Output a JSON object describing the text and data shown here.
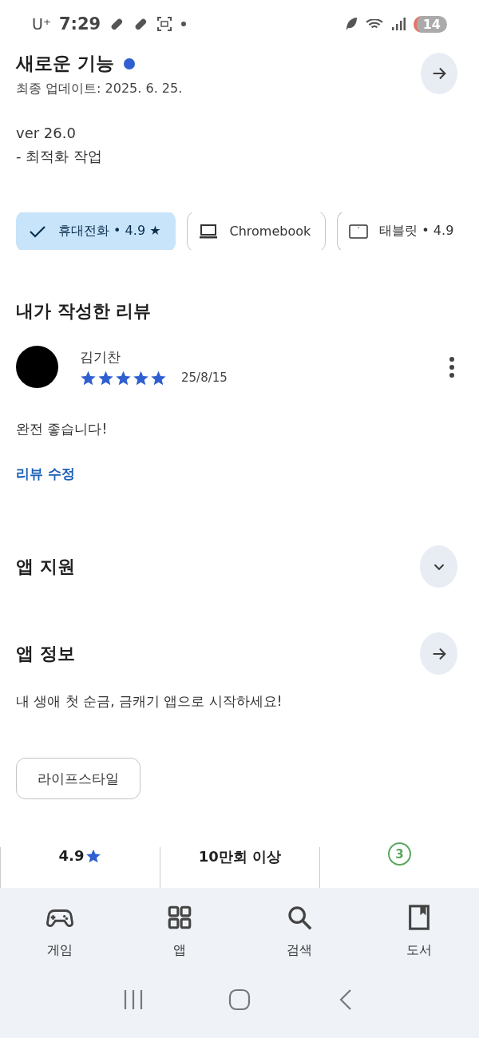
{
  "status_bar": {
    "carrier": "U⁺",
    "time": "7:29",
    "battery": "14"
  },
  "whats_new": {
    "title": "새로운 기능",
    "new_badge": true,
    "updated": "최종 업데이트: 2025. 6. 25.",
    "notes": [
      "ver 26.0",
      "- 최적화 작업"
    ]
  },
  "device_chips": [
    {
      "kind": "check",
      "label": "휴대전화 • 4.9 ★",
      "selected": true
    },
    {
      "kind": "laptop",
      "label": "Chromebook",
      "selected": false
    },
    {
      "kind": "tablet",
      "label": "태블릿 • 4.9",
      "selected": false
    }
  ],
  "my_review": {
    "heading": "내가 작성한 리뷰",
    "author": "김기찬",
    "stars": 5,
    "date": "25/8/15",
    "text": "완전 좋습니다!",
    "edit_link": "리뷰 수정"
  },
  "app_support": {
    "title": "앱 지원",
    "expanded": false
  },
  "app_info": {
    "title": "앱 정보",
    "description": "내 생애 첫 순금, 금캐기 앱으로 시작하세요!",
    "category": "라이프스타일"
  },
  "stats": [
    {
      "kind": "rating",
      "value": "4.9"
    },
    {
      "kind": "text",
      "value": "10만회 이상"
    },
    {
      "kind": "age",
      "value": "3"
    }
  ],
  "nav": [
    {
      "kind": "games",
      "label": "게임"
    },
    {
      "kind": "apps",
      "label": "앱"
    },
    {
      "kind": "search",
      "label": "검색"
    },
    {
      "kind": "books",
      "label": "도서"
    }
  ]
}
